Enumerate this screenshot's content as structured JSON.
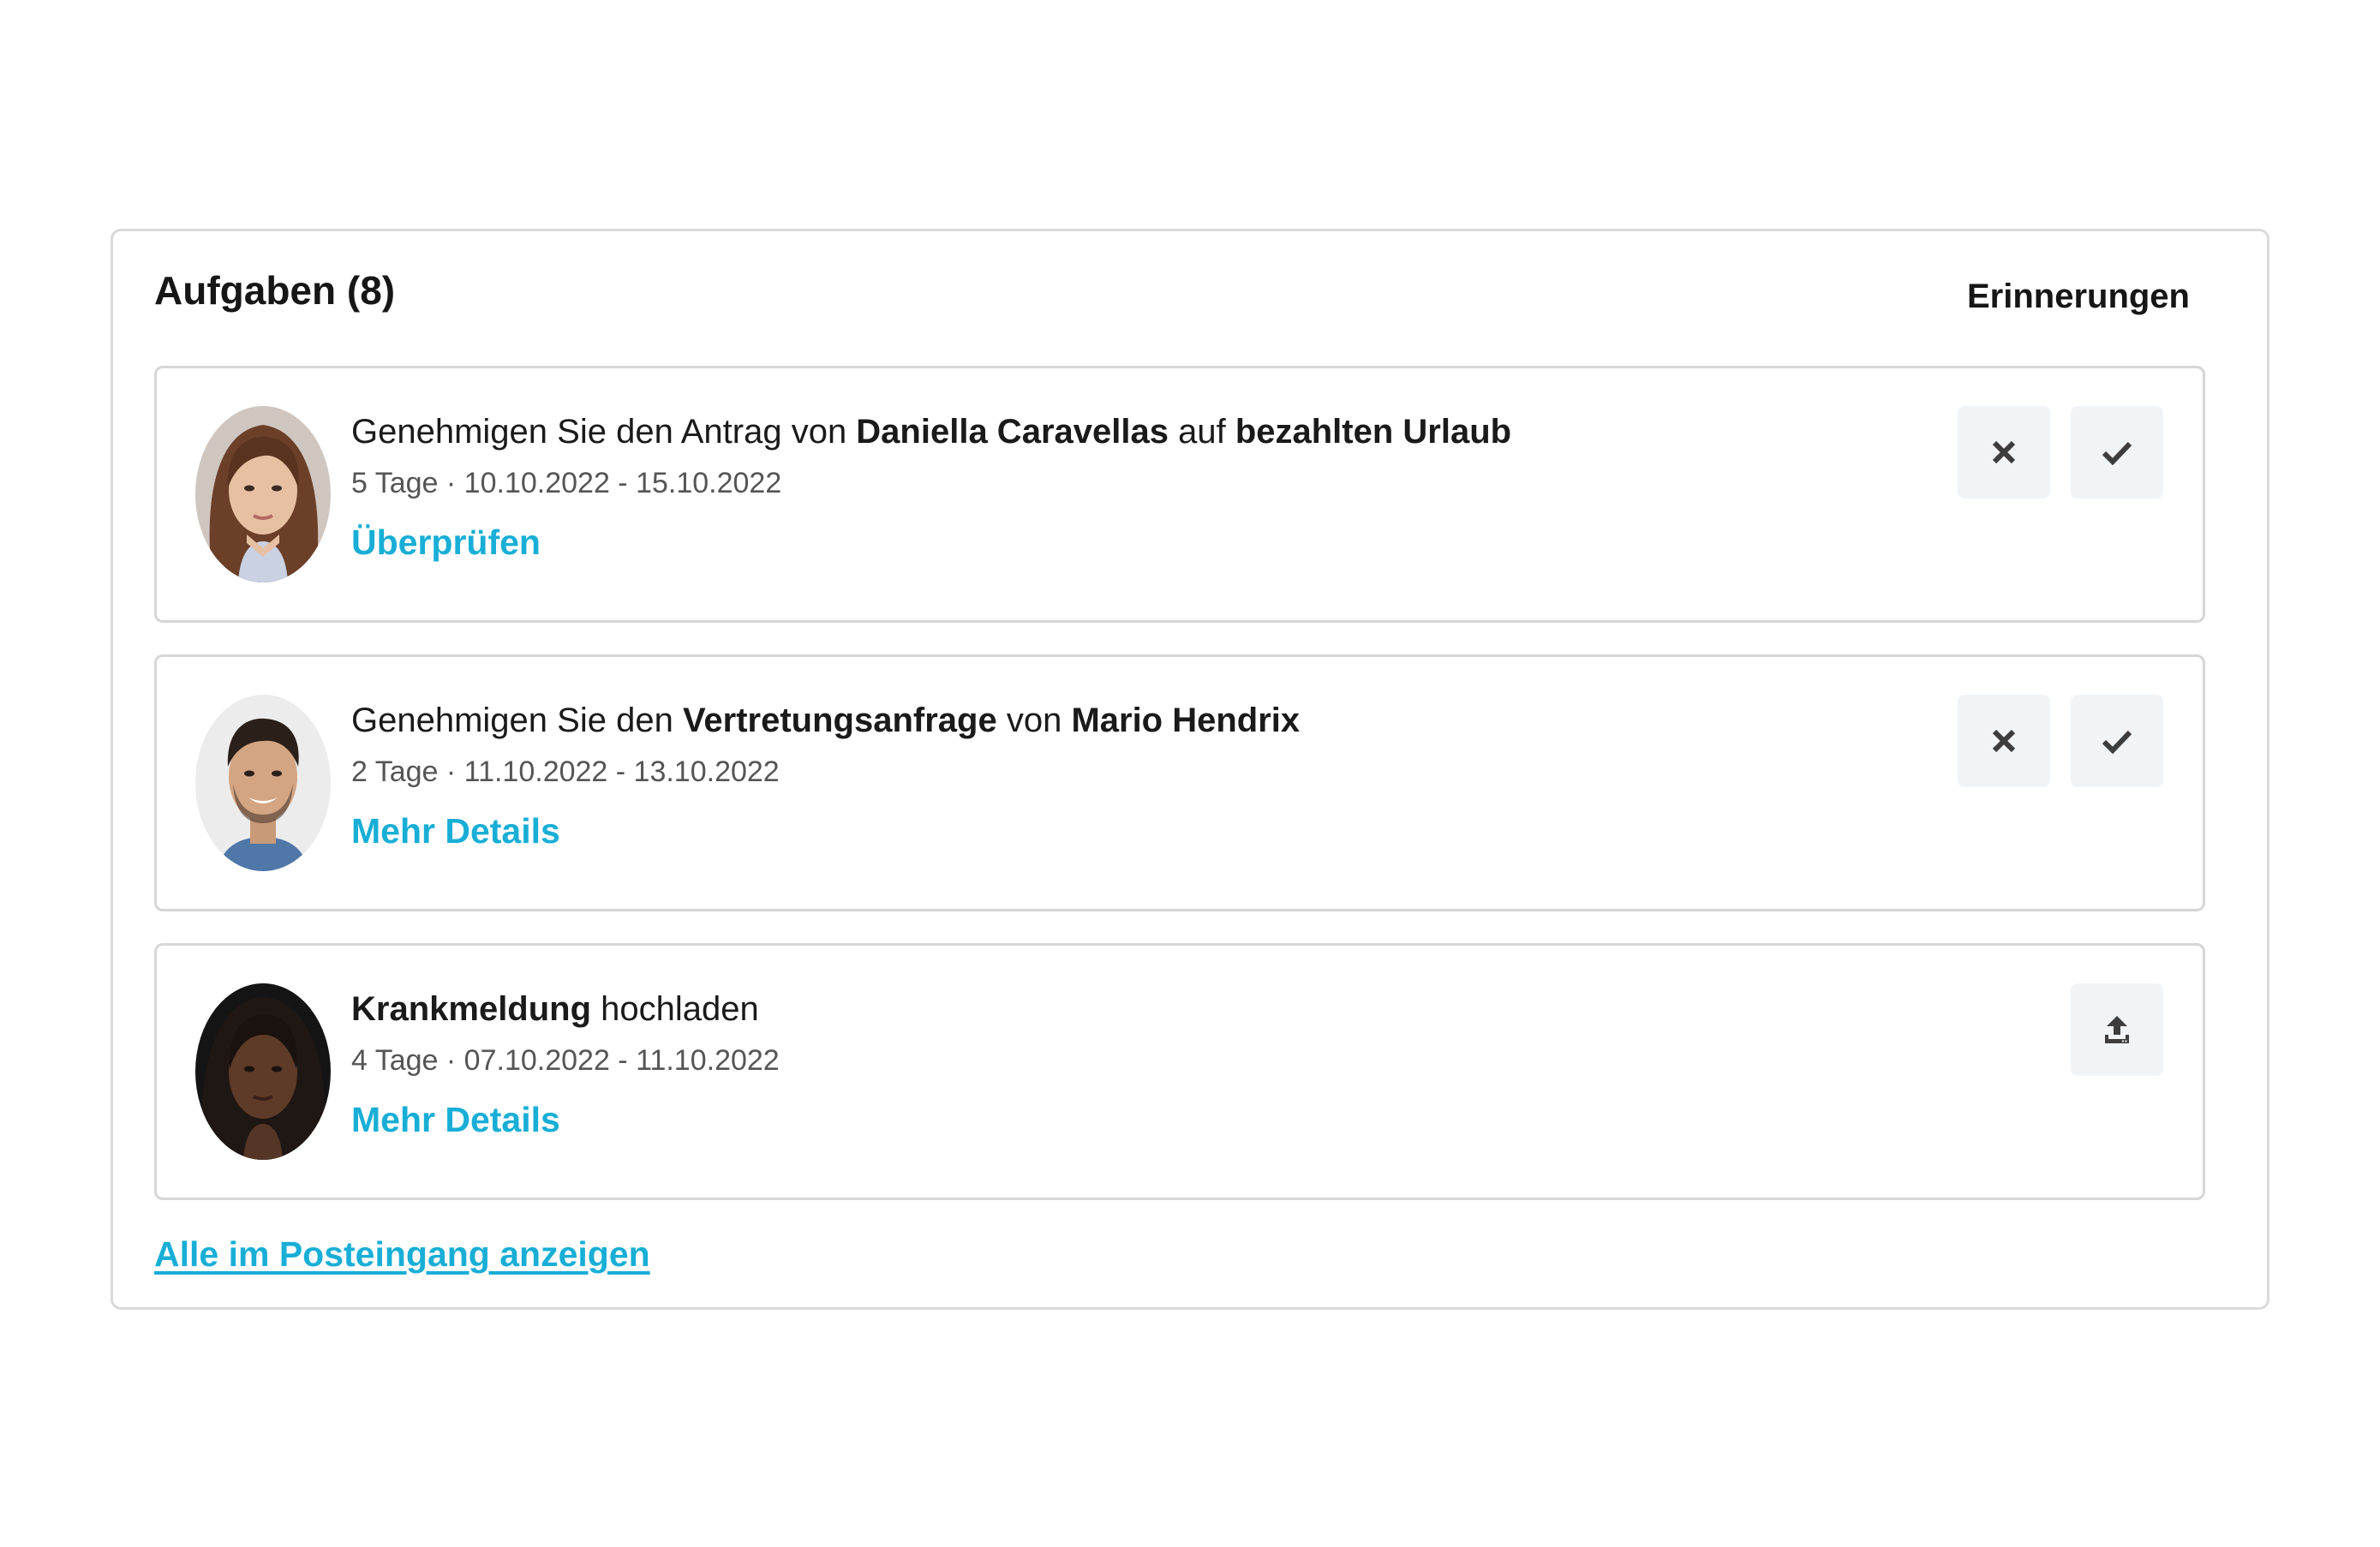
{
  "panel": {
    "title": "Aufgaben (8)",
    "reminders_label": "Erinnerungen",
    "inbox_link": "Alle im Posteingang anzeigen"
  },
  "tasks": [
    {
      "title_parts": [
        {
          "text": "Genehmigen Sie den Antrag von ",
          "bold": false
        },
        {
          "text": "Daniella Caravellas",
          "bold": true
        },
        {
          "text": " auf ",
          "bold": false
        },
        {
          "text": "bezahlten Urlaub",
          "bold": true
        }
      ],
      "meta": "5 Tage · 10.10.2022 - 15.10.2022",
      "link": "Überprüfen",
      "actions": [
        "decline",
        "approve"
      ],
      "avatar_icon": "person-photo-icon"
    },
    {
      "title_parts": [
        {
          "text": "Genehmigen Sie den ",
          "bold": false
        },
        {
          "text": "Vertretungsanfrage",
          "bold": true
        },
        {
          "text": " von ",
          "bold": false
        },
        {
          "text": "Mario Hendrix",
          "bold": true
        }
      ],
      "meta": "2 Tage · 11.10.2022 - 13.10.2022",
      "link": "Mehr Details",
      "actions": [
        "decline",
        "approve"
      ],
      "avatar_icon": "person-photo-icon"
    },
    {
      "title_parts": [
        {
          "text": "Krankmeldung",
          "bold": true
        },
        {
          "text": " hochladen",
          "bold": false
        }
      ],
      "meta": "4 Tage · 07.10.2022 - 11.10.2022",
      "link": "Mehr Details",
      "actions": [
        "upload"
      ],
      "avatar_icon": "person-photo-icon"
    }
  ],
  "colors": {
    "accent": "#18aed6",
    "button_bg": "#f1f4f7",
    "icon": "#3d3d3d",
    "border": "#d6d6d6"
  }
}
